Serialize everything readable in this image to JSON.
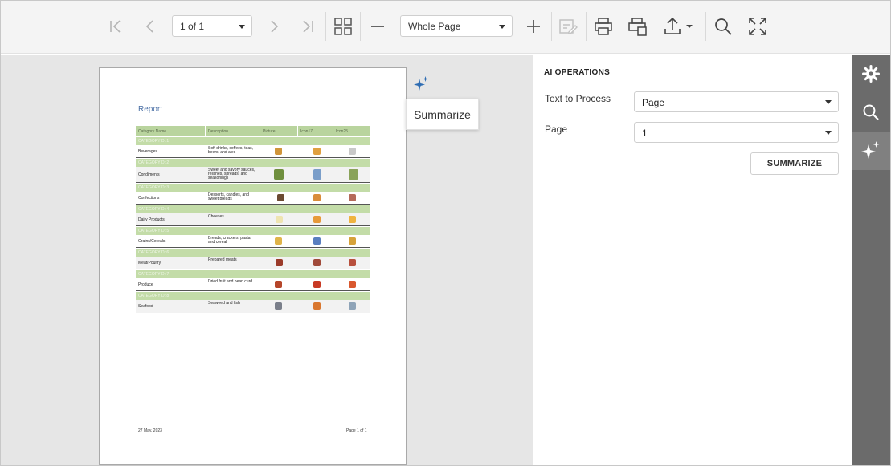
{
  "toolbar": {
    "page_selector": "1 of 1",
    "zoom_selector": "Whole Page"
  },
  "report": {
    "title": "Report",
    "columns": [
      "Category Name",
      "Description",
      "Picture",
      "Icon17",
      "Icon25"
    ],
    "category_label": "CATEGORYID",
    "groups": [
      {
        "id": "1",
        "name": "Beverages",
        "description": "Soft drinks, coffees, teas, beers, and ales"
      },
      {
        "id": "2",
        "name": "Condiments",
        "description": "Sweet and savory sauces, relishes, spreads, and seasonings"
      },
      {
        "id": "3",
        "name": "Confections",
        "description": "Desserts, candies, and sweet breads"
      },
      {
        "id": "4",
        "name": "Dairy Products",
        "description": "Cheeses"
      },
      {
        "id": "5",
        "name": "Grains/Cereals",
        "description": "Breads, crackers, pasta, and cereal"
      },
      {
        "id": "6",
        "name": "Meat/Poultry",
        "description": "Prepared meats"
      },
      {
        "id": "7",
        "name": "Produce",
        "description": "Dried fruit and bean curd"
      },
      {
        "id": "8",
        "name": "Seafood",
        "description": "Seaweed and fish"
      }
    ],
    "footer_date": "27 May, 2023",
    "footer_page": "Page 1 of 1"
  },
  "popup": {
    "summarize_label": "Summarize"
  },
  "ai_panel": {
    "title": "AI OPERATIONS",
    "text_to_process_label": "Text to Process",
    "text_to_process_value": "Page",
    "page_label": "Page",
    "page_value": "1",
    "summarize_button": "SUMMARIZE"
  },
  "colors": {
    "accent_blue": "#2f6db3",
    "tab_strip": "#6b6b6b",
    "report_header_green": "#b9d49e"
  }
}
